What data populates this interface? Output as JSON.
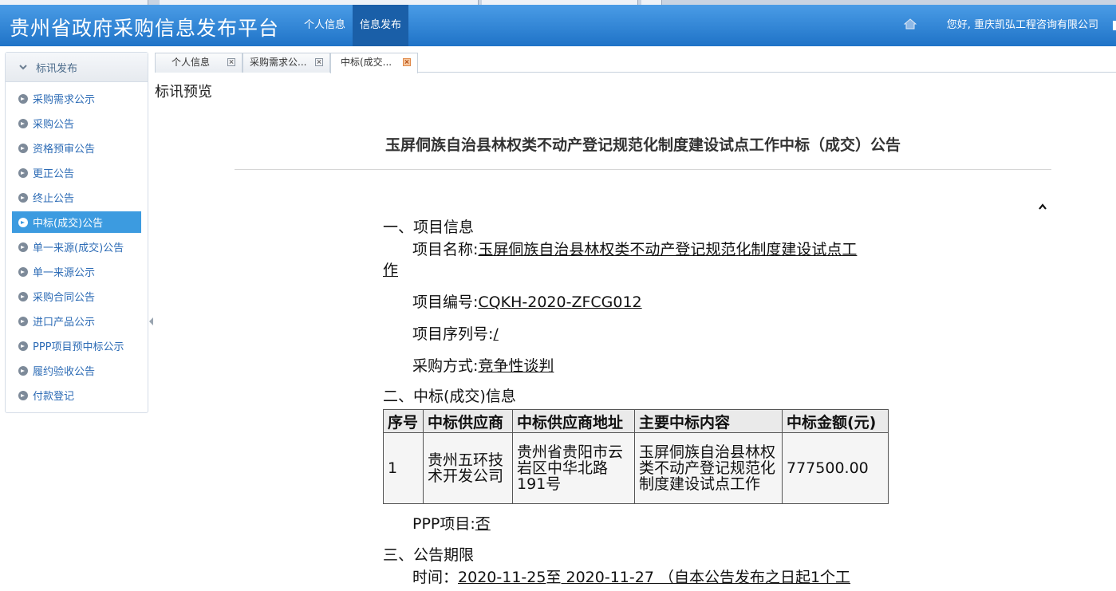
{
  "header": {
    "brand": "贵州省政府采购信息发布平台",
    "nav": [
      "个人信息",
      "信息发布"
    ],
    "active_nav": "信息发布",
    "greeting": "您好, 重庆凯弘工程咨询有限公司"
  },
  "sidebar": {
    "title": "标讯发布",
    "items": [
      "采购需求公示",
      "采购公告",
      "资格预审公告",
      "更正公告",
      "终止公告",
      "中标(成交)公告",
      "单一来源(成交)公告",
      "单一来源公示",
      "采购合同公告",
      "进口产品公示",
      "PPP项目预中标公示",
      "履约验收公告",
      "付款登记"
    ],
    "active_item": "中标(成交)公告"
  },
  "tabs": [
    "个人信息",
    "采购需求公...",
    "中标(成交..."
  ],
  "preview_label": "标讯预览",
  "document": {
    "title": "玉屏侗族自治县林权类不动产登记规范化制度建设试点工作中标（成交）公告",
    "section1": "一、项目信息",
    "project_name_label": "项目名称:",
    "project_name_line1": "玉屏侗族自治县林权类不动产登记规范化制度建设试点工",
    "project_name_line2": "作",
    "project_no_label": "项目编号:",
    "project_no": "CQKH-2020-ZFCG012",
    "serial_label": "项目序列号:",
    "serial": "/",
    "method_label": "采购方式:",
    "method": "竞争性谈判",
    "section2": "二、中标(成交)信息",
    "table_headers": [
      "序号",
      "中标供应商",
      "中标供应商地址",
      "主要中标内容",
      "中标金额(元)"
    ],
    "table_row": [
      "1",
      "贵州五环技术开发公司",
      "贵州省贵阳市云岩区中华北路191号",
      "玉屏侗族自治县林权类不动产登记规范化制度建设试点工作",
      "777500.00"
    ],
    "ppp_label": "PPP项目:",
    "ppp": "否",
    "section3": "三、公告期限",
    "time_label": "时间：",
    "time_start": "2020-11-25",
    "time_to": "至",
    "time_end": " 2020-11-27 （自本公告发布之日起1个工"
  }
}
